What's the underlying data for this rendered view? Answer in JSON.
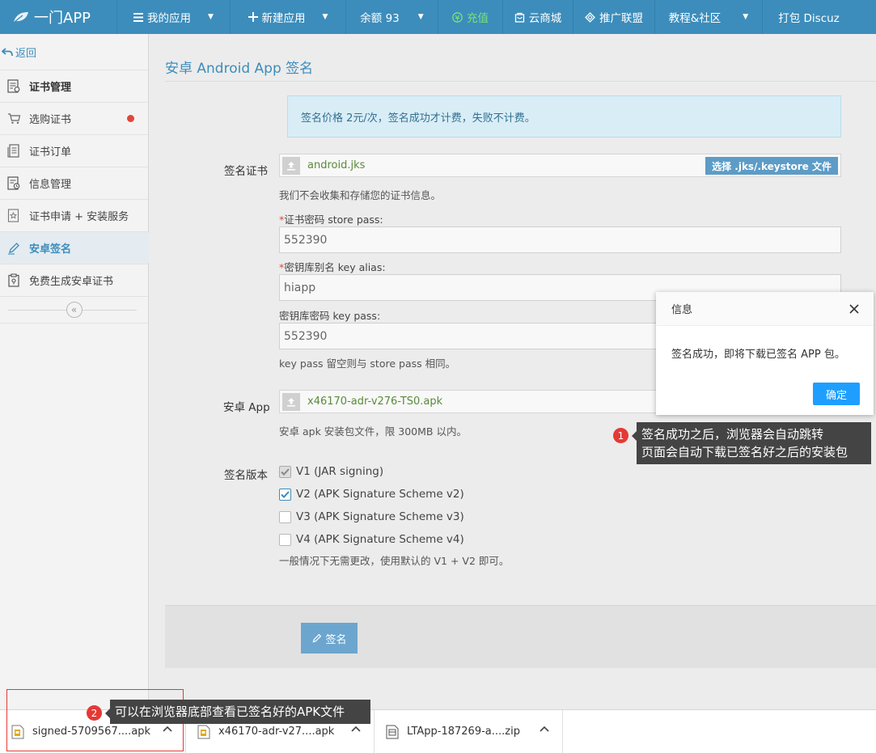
{
  "topnav": {
    "brand": "一门APP",
    "items": [
      {
        "label": "我的应用",
        "icon": "menu-icon",
        "caret": true
      },
      {
        "label": "新建应用",
        "icon": "plus-icon",
        "caret": true
      },
      {
        "label": "余额 93",
        "icon": "",
        "caret": true
      },
      {
        "label": "充值",
        "icon": "recharge-icon",
        "caret": false,
        "color": "#7be07a"
      },
      {
        "label": "云商城",
        "icon": "bag-icon",
        "caret": false
      },
      {
        "label": "推广联盟",
        "icon": "diamond-icon",
        "caret": false
      },
      {
        "label": "教程&社区",
        "icon": "",
        "caret": true
      },
      {
        "label": "打包 Discuz",
        "icon": "",
        "caret": false
      }
    ]
  },
  "sidebar": {
    "back": "返回",
    "items": [
      {
        "label": "证书管理",
        "icon": "certificate-icon",
        "type": "header"
      },
      {
        "label": "选购证书",
        "icon": "cart-icon",
        "badge": true
      },
      {
        "label": "证书订单",
        "icon": "order-icon"
      },
      {
        "label": "信息管理",
        "icon": "info-manage-icon"
      },
      {
        "label": "证书申请 + 安装服务",
        "icon": "star-doc-icon"
      },
      {
        "label": "安卓签名",
        "icon": "pen-icon",
        "active": true
      },
      {
        "label": "免费生成安卓证书",
        "icon": "clipboard-icon"
      }
    ]
  },
  "main": {
    "title": "安卓 Android App 签名",
    "notice": "签名价格 2元/次，签名成功才计费，失败不计费。",
    "cert": {
      "label": "签名证书",
      "filename": "android.jks",
      "pick_label": "选择 .jks/.keystore 文件",
      "help": "我们不会收集和存储您的证书信息。"
    },
    "store_pass": {
      "label": "证书密码 store pass:",
      "value": "552390"
    },
    "key_alias": {
      "label": "密钥库别名 key alias:",
      "value": "hiapp"
    },
    "key_pass": {
      "label": "密钥库密码 key pass:",
      "value": "552390",
      "help": "key pass 留空则与 store pass 相同。"
    },
    "app": {
      "label": "安卓 App",
      "filename": "x46170-adr-v276-TS0.apk",
      "help": "安卓 apk 安装包文件，限 300MB 以内。"
    },
    "version": {
      "label": "签名版本",
      "options": [
        {
          "label": "V1 (JAR signing)",
          "checked": true,
          "disabled": true
        },
        {
          "label": "V2 (APK Signature Scheme v2)",
          "checked": true,
          "disabled": false
        },
        {
          "label": "V3 (APK Signature Scheme v3)",
          "checked": false,
          "disabled": false
        },
        {
          "label": "V4 (APK Signature Scheme v4)",
          "checked": false,
          "disabled": false
        }
      ],
      "help": "一般情况下无需更改，使用默认的 V1 + V2 即可。"
    },
    "sign_button": "签名"
  },
  "dialog": {
    "title": "信息",
    "message": "签名成功，即将下载已签名 APP 包。",
    "ok": "确定"
  },
  "annotations": {
    "one": {
      "num": "1",
      "line1": "签名成功之后，浏览器会自动跳转",
      "line2": "页面会自动下载已签名好之后的安装包"
    },
    "two": {
      "num": "2",
      "text": "可以在浏览器底部查看已签名好的APK文件"
    }
  },
  "downloads": [
    {
      "name": "signed-5709567....apk",
      "icon": "apk-file-icon"
    },
    {
      "name": "x46170-adr-v27....apk",
      "icon": "apk-file-icon"
    },
    {
      "name": "LTApp-187269-a....zip",
      "icon": "zip-file-icon"
    }
  ]
}
